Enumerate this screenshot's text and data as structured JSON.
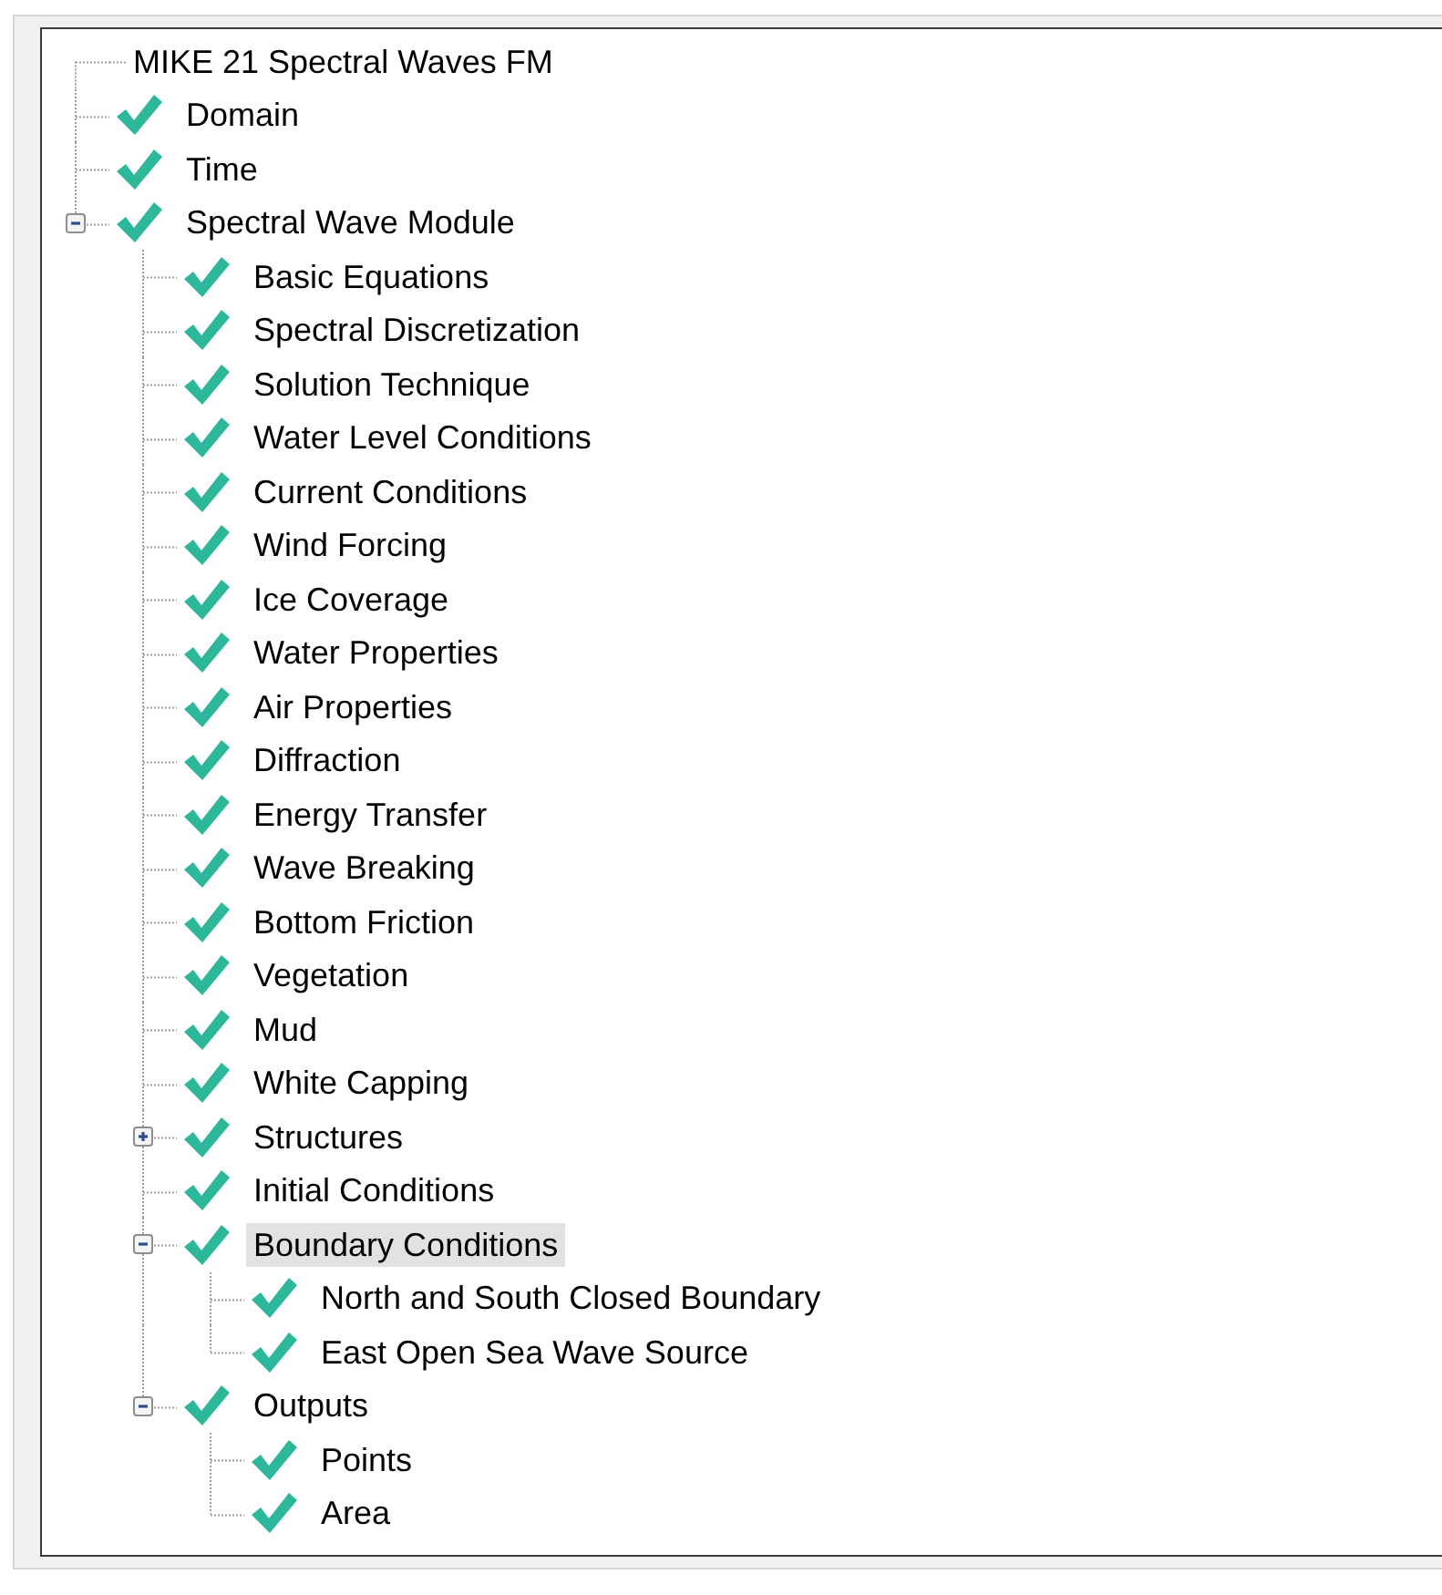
{
  "tree": {
    "items": [
      {
        "label": "MIKE 21 Spectral Waves FM",
        "checked": false,
        "selected": false
      },
      {
        "label": "Domain",
        "checked": true,
        "selected": false
      },
      {
        "label": "Time",
        "checked": true,
        "selected": false
      },
      {
        "label": "Spectral Wave Module",
        "checked": true,
        "expanded": true,
        "selected": false,
        "children": [
          {
            "label": "Basic Equations",
            "checked": true,
            "selected": false
          },
          {
            "label": "Spectral Discretization",
            "checked": true,
            "selected": false
          },
          {
            "label": "Solution Technique",
            "checked": true,
            "selected": false
          },
          {
            "label": "Water Level Conditions",
            "checked": true,
            "selected": false
          },
          {
            "label": "Current Conditions",
            "checked": true,
            "selected": false
          },
          {
            "label": "Wind Forcing",
            "checked": true,
            "selected": false
          },
          {
            "label": "Ice Coverage",
            "checked": true,
            "selected": false
          },
          {
            "label": "Water Properties",
            "checked": true,
            "selected": false
          },
          {
            "label": "Air Properties",
            "checked": true,
            "selected": false
          },
          {
            "label": "Diffraction",
            "checked": true,
            "selected": false
          },
          {
            "label": "Energy Transfer",
            "checked": true,
            "selected": false
          },
          {
            "label": "Wave Breaking",
            "checked": true,
            "selected": false
          },
          {
            "label": "Bottom Friction",
            "checked": true,
            "selected": false
          },
          {
            "label": "Vegetation",
            "checked": true,
            "selected": false
          },
          {
            "label": "Mud",
            "checked": true,
            "selected": false
          },
          {
            "label": "White Capping",
            "checked": true,
            "selected": false
          },
          {
            "label": "Structures",
            "checked": true,
            "expanded": false,
            "selected": false
          },
          {
            "label": "Initial Conditions",
            "checked": true,
            "selected": false
          },
          {
            "label": "Boundary Conditions",
            "checked": true,
            "expanded": true,
            "selected": true,
            "children": [
              {
                "label": "North and South Closed Boundary",
                "checked": true,
                "selected": false
              },
              {
                "label": "East Open Sea Wave Source",
                "checked": true,
                "selected": false
              }
            ]
          },
          {
            "label": "Outputs",
            "checked": true,
            "expanded": true,
            "selected": false,
            "children": [
              {
                "label": "Points",
                "checked": true,
                "selected": false
              },
              {
                "label": "Area",
                "checked": true,
                "selected": false
              }
            ]
          }
        ]
      }
    ]
  }
}
